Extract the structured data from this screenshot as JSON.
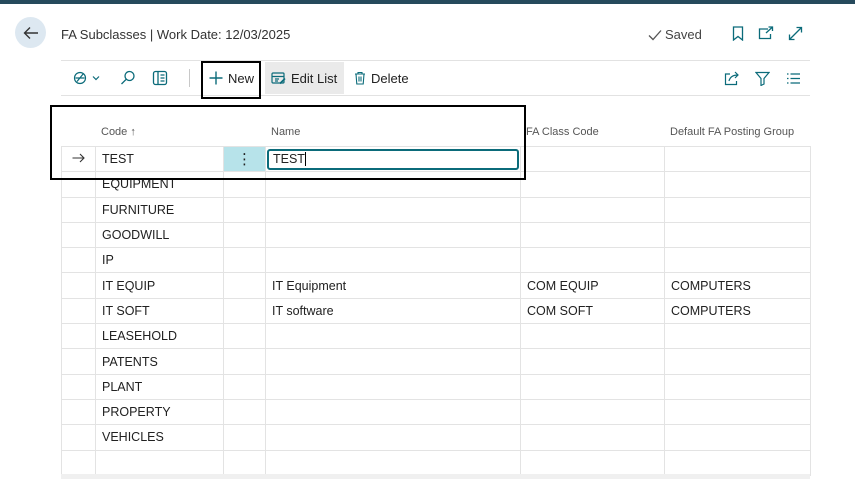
{
  "header": {
    "page_title": "FA Subclasses | Work Date: 12/03/2025",
    "saved_label": "Saved"
  },
  "toolbar": {
    "new_label": "New",
    "edit_list_label": "Edit List",
    "delete_label": "Delete"
  },
  "columns": {
    "code": "Code",
    "code_sort": "↑",
    "name": "Name",
    "fa_class_code": "FA Class Code",
    "default_fa_posting_group": "Default FA Posting Group"
  },
  "new_row": {
    "code": "TEST",
    "name_value": "TEST"
  },
  "rows": [
    {
      "code": "EQUIPMENT",
      "name": "",
      "fa_class_code": "",
      "posting_group": ""
    },
    {
      "code": "FURNITURE",
      "name": "",
      "fa_class_code": "",
      "posting_group": ""
    },
    {
      "code": "GOODWILL",
      "name": "",
      "fa_class_code": "",
      "posting_group": ""
    },
    {
      "code": "IP",
      "name": "",
      "fa_class_code": "",
      "posting_group": ""
    },
    {
      "code": "IT EQUIP",
      "name": "IT Equipment",
      "fa_class_code": "COM EQUIP",
      "posting_group": "COMPUTERS"
    },
    {
      "code": "IT SOFT",
      "name": "IT software",
      "fa_class_code": "COM SOFT",
      "posting_group": "COMPUTERS"
    },
    {
      "code": "LEASEHOLD",
      "name": "",
      "fa_class_code": "",
      "posting_group": ""
    },
    {
      "code": "PATENTS",
      "name": "",
      "fa_class_code": "",
      "posting_group": ""
    },
    {
      "code": "PLANT",
      "name": "",
      "fa_class_code": "",
      "posting_group": ""
    },
    {
      "code": "PROPERTY",
      "name": "",
      "fa_class_code": "",
      "posting_group": ""
    },
    {
      "code": "VEHICLES",
      "name": "",
      "fa_class_code": "",
      "posting_group": ""
    }
  ],
  "icons": {
    "back": "arrow-left-icon",
    "saved": "checkmark-icon",
    "bookmark": "bookmark-icon",
    "open_new": "open-new-window-icon",
    "expand": "expand-icon",
    "analysis": "analysis-mode-icon",
    "search": "search-icon",
    "filter_pane": "filter-pane-icon",
    "share": "share-icon",
    "filter": "filter-icon",
    "list_view": "list-view-icon"
  },
  "colors": {
    "accent": "#0b6b7a",
    "topbar": "#264a5c",
    "selected_cell": "#b7e3ea"
  }
}
